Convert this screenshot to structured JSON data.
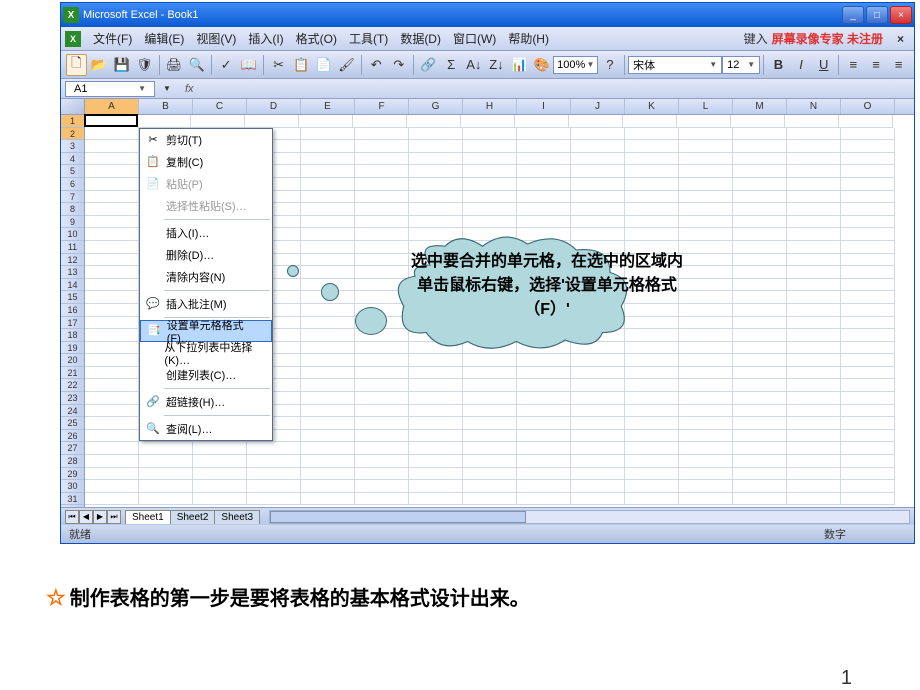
{
  "window": {
    "title": "Microsoft Excel - Book1"
  },
  "menu": {
    "items": [
      "文件(F)",
      "编辑(E)",
      "视图(V)",
      "插入(I)",
      "格式(O)",
      "工具(T)",
      "数据(D)",
      "窗口(W)",
      "帮助(H)"
    ],
    "right_text": "键入",
    "right_red": "屏幕录像专家 未注册"
  },
  "toolbar": {
    "zoom": "100%",
    "font": "宋体",
    "font_size": "12",
    "buttons": {
      "bold": "B",
      "italic": "I",
      "underline": "U"
    }
  },
  "name_box": "A1",
  "fx": "fx",
  "columns": [
    "A",
    "B",
    "C",
    "D",
    "E",
    "F",
    "G",
    "H",
    "I",
    "J",
    "K",
    "L",
    "M",
    "N",
    "O"
  ],
  "row_count": 31,
  "context_menu": {
    "cut": "剪切(T)",
    "copy": "复制(C)",
    "paste": "粘贴(P)",
    "paste_special": "选择性粘贴(S)…",
    "insert": "插入(I)…",
    "delete": "删除(D)…",
    "clear": "清除内容(N)",
    "insert_comment": "插入批注(M)",
    "format_cells": "设置单元格格式(F)…",
    "pick_from_list": "从下拉列表中选择(K)…",
    "create_list": "创建列表(C)…",
    "hyperlink": "超链接(H)…",
    "lookup": "查阅(L)…"
  },
  "callout_text": "选中要合并的单元格，在选中的区域内单击鼠标右键，选择'设置单元格格式（F）'",
  "sheets": [
    "Sheet1",
    "Sheet2",
    "Sheet3"
  ],
  "status": {
    "left": "就绪",
    "right": "数字"
  },
  "bottom_note": "制作表格的第一步是要将表格的基本格式设计出来。",
  "page_number": "1"
}
